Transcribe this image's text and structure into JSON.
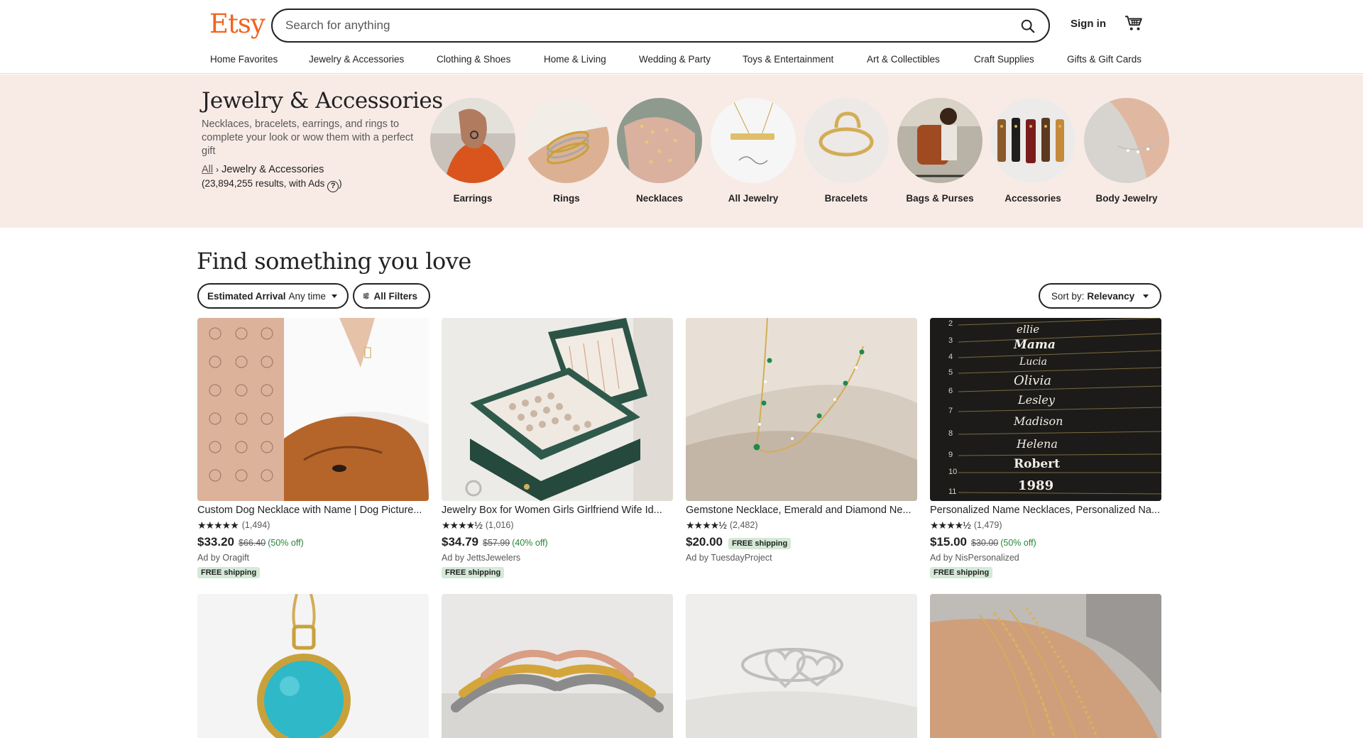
{
  "header": {
    "logo": "Etsy",
    "search_placeholder": "Search for anything",
    "sign_in": "Sign in"
  },
  "nav": [
    "Home Favorites",
    "Jewelry & Accessories",
    "Clothing & Shoes",
    "Home & Living",
    "Wedding & Party",
    "Toys & Entertainment",
    "Art & Collectibles",
    "Craft Supplies",
    "Gifts & Gift Cards"
  ],
  "hero": {
    "title": "Jewelry & Accessories",
    "description": "Necklaces, bracelets, earrings, and rings to complete your look or wow them with a perfect gift",
    "breadcrumb_all": "All",
    "breadcrumb_current": "Jewelry & Accessories",
    "results_text": "(23,894,255 results, with Ads",
    "results_close": ")",
    "help_icon": "?",
    "categories": [
      "Earrings",
      "Rings",
      "Necklaces",
      "All Jewelry",
      "Bracelets",
      "Bags & Purses",
      "Accessories",
      "Body Jewelry"
    ]
  },
  "main": {
    "title": "Find something you love",
    "filters": {
      "arrival_label": "Estimated Arrival",
      "arrival_value": "Any time",
      "all_filters": "All Filters",
      "sort_label": "Sort by:",
      "sort_value": "Relevancy"
    },
    "products": [
      {
        "title": "Custom Dog Necklace with Name | Dog Picture...",
        "stars": "★★★★★",
        "reviews": "(1,494)",
        "price": "$33.20",
        "original": "$66.40",
        "discount": "(50% off)",
        "free_inline": "",
        "ad_by": "Ad by Oragift",
        "free_below": "FREE shipping"
      },
      {
        "title": "Jewelry Box for Women Girls Girlfriend Wife Id...",
        "stars": "★★★★½",
        "reviews": "(1,016)",
        "price": "$34.79",
        "original": "$57.99",
        "discount": "(40% off)",
        "free_inline": "",
        "ad_by": "Ad by JettsJewelers",
        "free_below": "FREE shipping"
      },
      {
        "title": "Gemstone Necklace, Emerald and Diamond Ne...",
        "stars": "★★★★½",
        "reviews": "(2,482)",
        "price": "$20.00",
        "original": "",
        "discount": "",
        "free_inline": "FREE shipping",
        "ad_by": "Ad by TuesdayProject",
        "free_below": ""
      },
      {
        "title": "Personalized Name Necklaces, Personalized Na...",
        "stars": "★★★★½",
        "reviews": "(1,479)",
        "price": "$15.00",
        "original": "$30.00",
        "discount": "(50% off)",
        "free_inline": "",
        "ad_by": "Ad by NisPersonalized",
        "free_below": "FREE shipping"
      }
    ],
    "name_necklace_names": [
      "ellie",
      "Mama",
      "Lucia",
      "Olivia",
      "Lesley",
      "Madison",
      "Helena",
      "Robert",
      "1989"
    ],
    "name_necklace_lengths": [
      "2",
      "3",
      "4",
      "5",
      "6",
      "7",
      "8",
      "9",
      "10",
      "11"
    ]
  },
  "colors": {
    "brand": "#f1641e",
    "hero_bg": "#f8ebe6",
    "free_shipping_bg": "#d4e9d7",
    "discount": "#258635"
  },
  "icons": [
    "search-icon",
    "cart-icon",
    "chevron-right-icon",
    "help-icon",
    "caret-down-icon",
    "filter-icon"
  ]
}
